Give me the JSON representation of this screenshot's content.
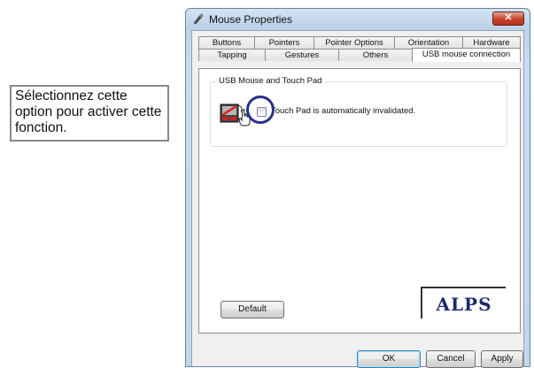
{
  "callout": {
    "text": "Sélectionnez cette option pour activer cette fonction."
  },
  "window": {
    "title": "Mouse Properties",
    "close_label": "✕",
    "tabs_row1": [
      "Buttons",
      "Pointers",
      "Pointer Options",
      "Orientation",
      "Hardware"
    ],
    "tabs_row2": [
      "Tapping",
      "Gestures",
      "Others",
      "USB mouse connection"
    ],
    "active_tab": "USB mouse connection",
    "group": {
      "title": "USB Mouse and Touch Pad",
      "checkbox_label": "Touch Pad is automatically invalidated.",
      "checked": false
    },
    "logo_text": "ALPS",
    "buttons": {
      "default": "Default",
      "ok": "OK",
      "cancel": "Cancel",
      "apply": "Apply"
    }
  },
  "icons": {
    "title": "mouse-icon",
    "device": "usb-mouse-touchpad-icon",
    "cursor": "hand-cursor-icon"
  },
  "colors": {
    "highlight": "#2a2f8c",
    "close": "#c9472e",
    "logo": "#1f2a6b"
  }
}
